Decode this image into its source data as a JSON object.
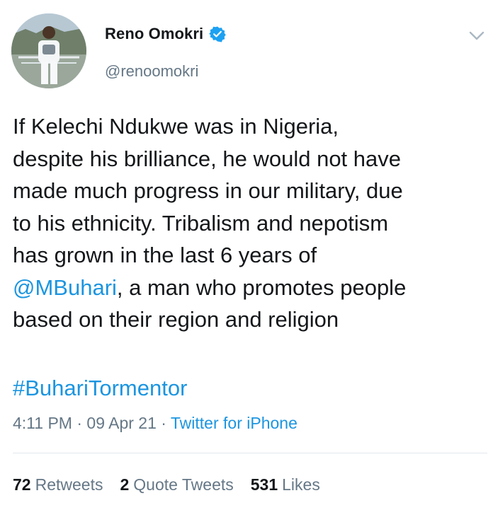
{
  "author": {
    "display_name": "Reno Omokri",
    "handle": "@renoomokri",
    "verified": true
  },
  "tweet": {
    "lines_before_mention": [
      "If Kelechi Ndukwe was in Nigeria,",
      "despite his brilliance, he would not have",
      "made much progress in our military, due",
      "to his ethnicity. Tribalism and nepotism",
      "has grown in the last 6 years of"
    ],
    "mention": "@MBuhari",
    "after_mention": ", a man who promotes people",
    "last_line": "based on their region and religion",
    "hashtag": "#BuhariTormentor"
  },
  "meta": {
    "time": "4:11 PM",
    "separator": "·",
    "date": "09 Apr 21",
    "source": "Twitter for iPhone"
  },
  "stats": {
    "retweets_count": "72",
    "retweets_label": "Retweets",
    "quotes_count": "2",
    "quotes_label": "Quote Tweets",
    "likes_count": "531",
    "likes_label": "Likes"
  },
  "colors": {
    "link": "#1b95e0",
    "text": "#14171a",
    "secondary": "#657786",
    "divider": "#e1e8ed"
  },
  "icons": [
    "avatar",
    "verified-badge-icon",
    "chevron-down-icon"
  ]
}
